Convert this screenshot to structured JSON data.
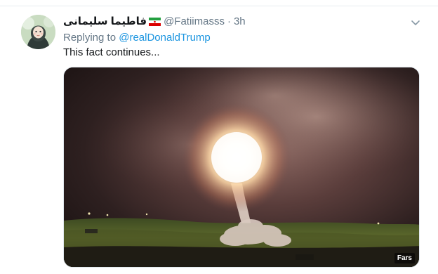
{
  "tweet": {
    "display_name": "فاطیما سلیمانی",
    "flag_icon": "iran-flag-icon",
    "handle": "@Fatiimasss",
    "separator": "·",
    "time": "3h",
    "replying_label": "Replying to",
    "reply_to": "@realDonaldTrump",
    "text": "This fact continues...",
    "media": {
      "description_icon": "missile-launch-photo",
      "watermark": "Fars"
    },
    "menu_icon": "chevron-down-icon"
  },
  "colors": {
    "text_primary": "#14171a",
    "text_secondary": "#657786",
    "link": "#1b95e0",
    "divider": "#e6ecf0"
  }
}
